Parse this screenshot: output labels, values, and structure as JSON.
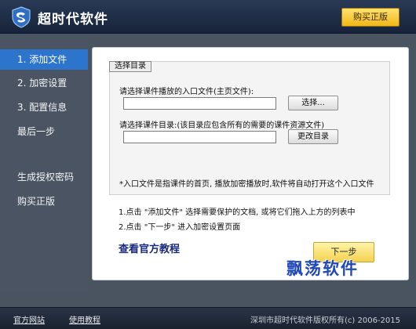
{
  "app": {
    "title": "超时代软件",
    "buy_label": "购买正版"
  },
  "sidebar": {
    "items": [
      {
        "label": "1. 添加文件",
        "active": true
      },
      {
        "label": "2. 加密设置"
      },
      {
        "label": "3. 配置信息"
      },
      {
        "label": "最后一步"
      },
      {
        "label": "生成授权密码"
      },
      {
        "label": "购买正版"
      }
    ]
  },
  "main": {
    "group_title": "选择目录",
    "entry_label": "请选择课件播放的入口文件(主页文件):",
    "entry_value": "",
    "browse_label": "选择...",
    "dir_label": "请选择课件目录:(该目录应包含所有的需要的课件资源文件)",
    "dir_value": "",
    "change_dir_label": "更改目录",
    "note": "*入口文件是指课件的首页, 播放加密播放时,软件将自动打开这个入口文件",
    "steps": [
      "1.点击 \"添加文件\" 选择需要保护的文档, 或将它们拖入上方的列表中",
      "2.点击 \"下一步\" 进入加密设置页面"
    ],
    "tutorial_label": "查看官方教程",
    "next_label": "下一步"
  },
  "watermark": "飘荡软件",
  "footer": {
    "site_label": "官方网站",
    "help_label": "使用教程",
    "copyright": "深圳市超时代软件版权所有(c) 2006-2015"
  },
  "colors": {
    "active_item": "#2d74cc",
    "buy_button": "#f0b818",
    "link": "#1a2a80",
    "watermark": "#1f48b8"
  }
}
